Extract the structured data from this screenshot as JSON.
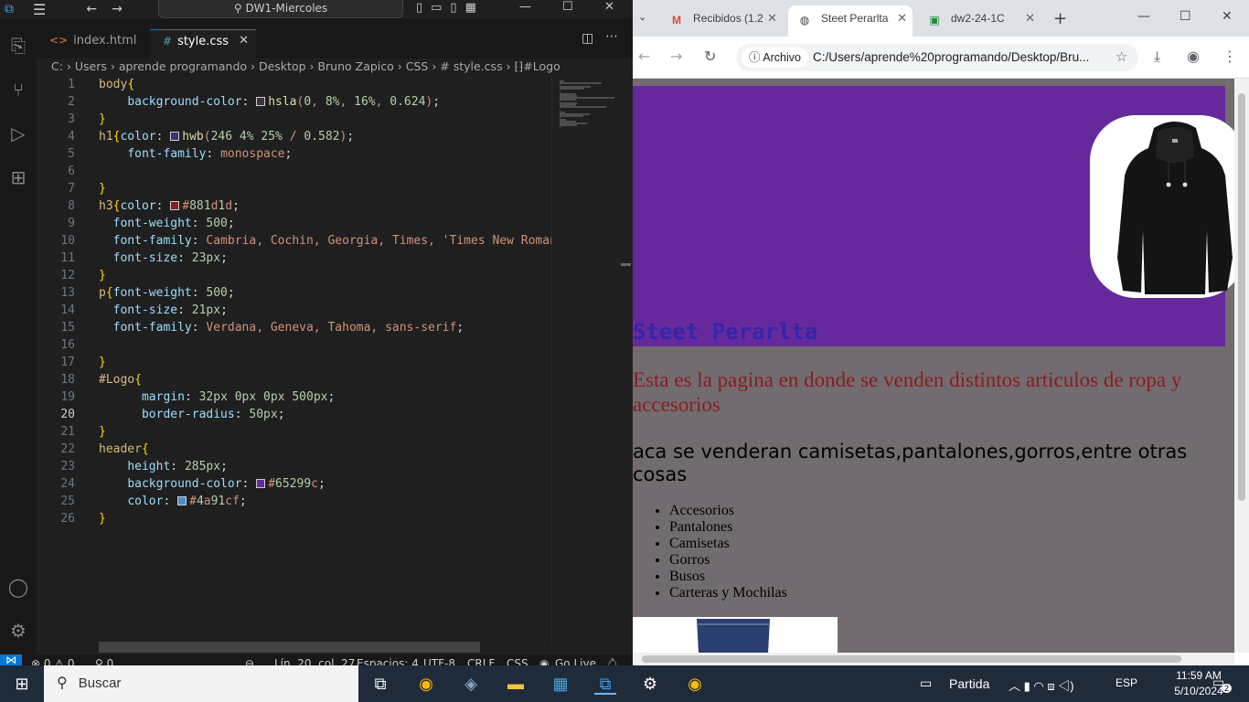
{
  "vscode": {
    "search_title": "DW1-Miercoles",
    "tabs": [
      {
        "label": "index.html",
        "icon": "<>"
      },
      {
        "label": "style.css",
        "icon": "#"
      }
    ],
    "breadcrumb": "C: › Users › aprende programando › Desktop › Bruno Zapico › CSS › # style.css › ⁅⁆#Logo",
    "current_line": 20,
    "code_lines": [
      "body{",
      "    background-color: hsla(0, 8%, 16%, 0.624);",
      "}",
      "h1{color: hwb(246 4% 25% / 0.582);",
      "    font-family: monospace;",
      "",
      "}",
      "h3{color: #881d1d;",
      "  font-weight: 500;",
      "  font-family: Cambria, Cochin, Georgia, Times, 'Times New Roman",
      "  font-size: 23px;",
      "}",
      "p{font-weight: 500;",
      "  font-size: 21px;",
      "  font-family: Verdana, Geneva, Tahoma, sans-serif;",
      "",
      "}",
      "#Logo{",
      "      margin: 32px 0px 0px 500px;",
      "      border-radius: 50px;",
      "}",
      "header{",
      "    height: 285px;",
      "    background-color: #65299c;",
      "    color: #4a91cf;",
      "}"
    ],
    "swatches": {
      "line2": "#3b3435",
      "line4": "#37337a",
      "line8": "#881d1d",
      "line24": "#65299c",
      "line25": "#4a91cf"
    },
    "status": {
      "errors": "⊗ 0 ⚠ 0",
      "ports": "⚲ 0",
      "position": "Lín. 20, col. 27",
      "spaces": "Espacios: 4",
      "encoding": "UTF-8",
      "eol": "CRLF",
      "language": "CSS",
      "golive": "Go Live"
    }
  },
  "chrome": {
    "tabs": [
      {
        "label": "Recibidos (1.2",
        "icon": "gmail-icon"
      },
      {
        "label": "Steet Perarlta",
        "icon": "globe-icon"
      },
      {
        "label": "dw2-24-1C",
        "icon": "classroom-icon"
      }
    ],
    "omnibox_chip": "Archivo",
    "url": "C:/Users/aprende%20programando/Desktop/Bru...",
    "page": {
      "title": "Steet Perarlta",
      "description": "Esta es la pagina en donde se venden distintos articulos de ropa y accesorios",
      "paragraph": "aca se venderan camisetas,pantalones,gorros,entre otras cosas",
      "list": [
        "Accesorios",
        "Pantalones",
        "Camisetas",
        "Gorros",
        "Busos",
        "Carteras y Mochilas"
      ]
    },
    "colors": {
      "header_bg": "#65299c",
      "page_bg": "#726c70",
      "h3": "#881d1d"
    }
  },
  "taskbar": {
    "search_placeholder": "Buscar",
    "weather": "Partida",
    "language": "ESP",
    "time": "11:59 AM",
    "date": "5/10/2024",
    "notifications": "2"
  }
}
